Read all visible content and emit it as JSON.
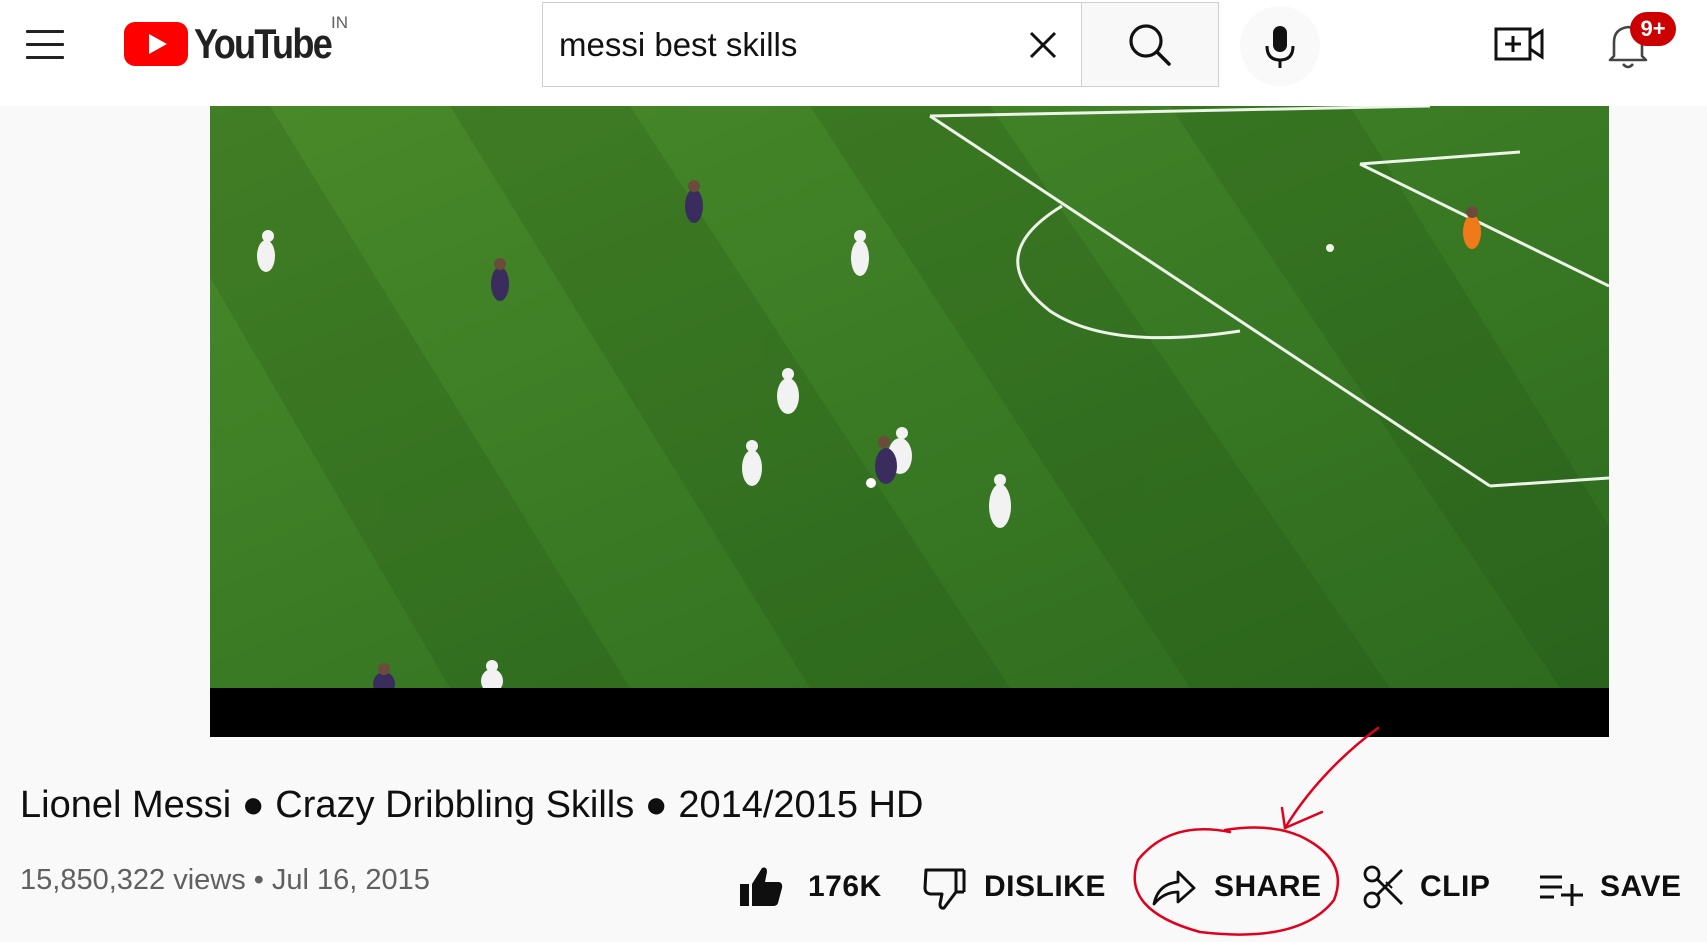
{
  "header": {
    "logo_text": "YouTube",
    "country_code": "IN",
    "search": {
      "value": "messi best skills"
    },
    "notifications_badge": "9+"
  },
  "video": {
    "title": "Lionel Messi ● Crazy Dribbling Skills ● 2014/2015 HD",
    "views": "15,850,322 views",
    "separator": "•",
    "date": "Jul 16, 2015"
  },
  "actions": {
    "like_count": "176K",
    "dislike_label": "DISLIKE",
    "share_label": "SHARE",
    "clip_label": "CLIP",
    "save_label": "SAVE"
  },
  "colors": {
    "brand_red": "#ff0000",
    "badge_red": "#cc0000",
    "annotation_red": "#e0001b",
    "pitch_green": "#3f7d24"
  },
  "icons": [
    "menu-icon",
    "youtube-logo-icon",
    "clear-icon",
    "search-icon",
    "mic-icon",
    "create-video-icon",
    "bell-icon",
    "like-icon",
    "dislike-icon",
    "share-icon",
    "clip-icon",
    "save-icon"
  ]
}
